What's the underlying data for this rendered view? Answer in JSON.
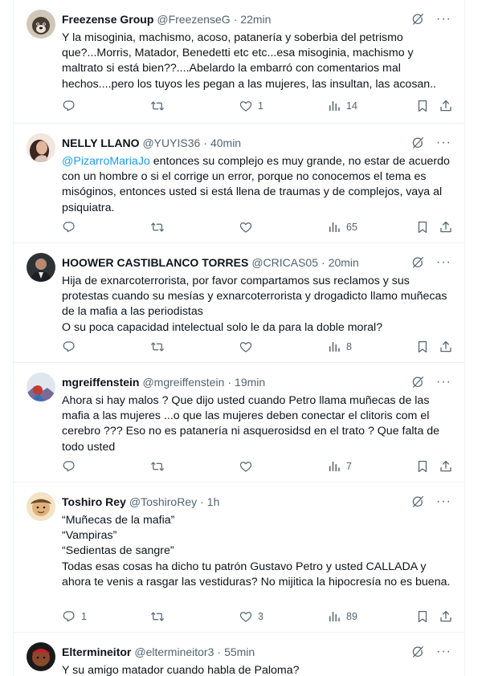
{
  "tweets": [
    {
      "name": "Freezense Group",
      "handle": "@FreezenseG",
      "time": "22min",
      "mention": "",
      "text": "Y la misoginia, machismo, acoso, patanería y soberbia del petrismo que?...Morris, Matador, Benedetti etc etc...esa misoginia, machismo y maltrato si está bien??....Abelardo la embarró con comentarios mal hechos....pero los tuyos les pegan a las mujeres, las insultan, las acosan..",
      "replies": "",
      "retweets": "",
      "likes": "1",
      "views": "14"
    },
    {
      "name": "NELLY LLANO",
      "handle": "@YUYIS36",
      "time": "40min",
      "mention": "@PizarroMariaJo",
      "text": "entonces su complejo es muy grande, no estar de acuerdo con un hombre o si el corrige un error, porque no conocemos el tema es misóginos, entonces usted si está llena de traumas y de complejos, vaya al psiquiatra.",
      "replies": "",
      "retweets": "",
      "likes": "",
      "views": "65"
    },
    {
      "name": "HOOWER CASTIBLANCO TORRES",
      "handle": "@CRICAS05",
      "time": "20min",
      "mention": "",
      "text": "Hija de exnarcoterrorista, por favor compartamos sus reclamos y sus protestas cuando su mesías y exnarcoterrorista y drogadicto llamo muñecas de la mafia a las periodistas\nO su poca capacidad intelectual solo le da para la doble moral?",
      "replies": "",
      "retweets": "",
      "likes": "",
      "views": "8"
    },
    {
      "name": "mgreiffenstein",
      "handle": "@mgreiffenstein",
      "time": "19min",
      "mention": "",
      "text": "Ahora si hay malos ? Que dijo usted cuando Petro llama muñecas de las mafia a las mujeres ...o que las mujeres deben conectar el clitoris com el cerebro ??? Eso no es patanería ni asquerosidsd en el trato ? Que falta de todo usted",
      "replies": "",
      "retweets": "",
      "likes": "",
      "views": "7"
    },
    {
      "name": "Toshiro Rey",
      "handle": "@ToshiroRey",
      "time": "1h",
      "mention": "",
      "text": "“Muñecas de la mafia”\n“Vampiras”\n“Sedientas de sangre”\nTodas esas cosas ha dicho tu patrón Gustavo Petro y usted CALLADA y ahora te venis a rasgar las vestiduras? No mijitica la hipocresía no es buena.",
      "replies": "1",
      "retweets": "",
      "likes": "3",
      "views": "89"
    },
    {
      "name": "Eltermineitor",
      "handle": "@eltermineitor3",
      "time": "55min",
      "mention": "",
      "text": "Y su amigo matador cuando habla de Paloma?",
      "replies": "",
      "retweets": "",
      "likes": "",
      "views": ""
    }
  ],
  "separator": "·",
  "more_glyph": "···",
  "icons": {
    "reply": "reply-icon",
    "retweet": "retweet-icon",
    "like": "heart-icon",
    "views": "views-icon",
    "bookmark": "bookmark-icon",
    "share": "share-icon",
    "grok": "grok-icon",
    "more": "more-icon"
  },
  "colors": {
    "text": "#0f1419",
    "secondary": "#536471",
    "link": "#1d9bf0",
    "border": "#eff3f4"
  }
}
